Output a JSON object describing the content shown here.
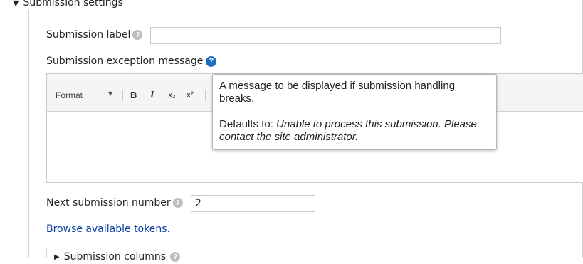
{
  "fieldset": {
    "legend": "Submission settings",
    "submission_label": {
      "label": "Submission label",
      "value": ""
    },
    "exception_message": {
      "label": "Submission exception message"
    },
    "editor_toolbar": {
      "format_label": "Format",
      "bold": "B",
      "italic": "I",
      "subscript": "x₂",
      "superscript": "x²"
    },
    "tooltip": {
      "text": "A message to be displayed if submission handling breaks.",
      "defaults_prefix": "Defaults to: ",
      "default_value": "Unable to process this submission. Please contact the site administrator."
    },
    "next_number": {
      "label": "Next submission number",
      "value": "2"
    },
    "browse_link": "Browse available tokens."
  },
  "columns_fieldset": {
    "legend": "Submission columns"
  },
  "icons": {
    "help": "help-icon",
    "expand": "triangle-icon"
  },
  "colors": {
    "help_blue": "#1b6fbf",
    "help_grey": "#bdbdbd",
    "link": "#0a3ea7"
  }
}
